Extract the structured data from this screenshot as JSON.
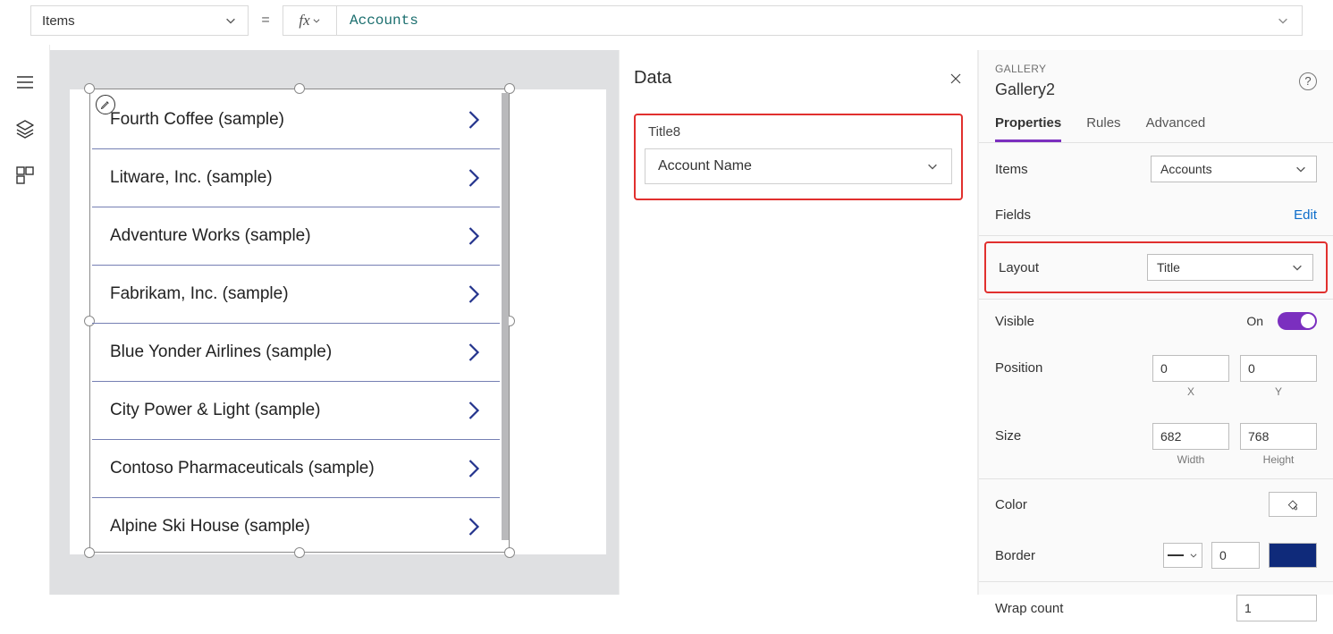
{
  "formula_bar": {
    "property": "Items",
    "equals": "=",
    "formula": "Accounts"
  },
  "gallery_items": [
    {
      "title": "Fourth Coffee (sample)"
    },
    {
      "title": "Litware, Inc. (sample)"
    },
    {
      "title": "Adventure Works (sample)"
    },
    {
      "title": "Fabrikam, Inc. (sample)"
    },
    {
      "title": "Blue Yonder Airlines (sample)"
    },
    {
      "title": "City Power & Light (sample)"
    },
    {
      "title": "Contoso Pharmaceuticals (sample)"
    },
    {
      "title": "Alpine Ski House (sample)"
    }
  ],
  "data_panel": {
    "title": "Data",
    "field_label": "Title8",
    "field_value": "Account Name"
  },
  "prop_panel": {
    "eyebrow": "GALLERY",
    "name": "Gallery2",
    "tabs": {
      "properties": "Properties",
      "rules": "Rules",
      "advanced": "Advanced"
    },
    "items_label": "Items",
    "items_value": "Accounts",
    "fields_label": "Fields",
    "fields_edit": "Edit",
    "layout_label": "Layout",
    "layout_value": "Title",
    "visible_label": "Visible",
    "visible_value": "On",
    "position_label": "Position",
    "pos_x": "0",
    "pos_y": "0",
    "pos_x_cap": "X",
    "pos_y_cap": "Y",
    "size_label": "Size",
    "width": "682",
    "height": "768",
    "width_cap": "Width",
    "height_cap": "Height",
    "color_label": "Color",
    "border_label": "Border",
    "border_width": "0",
    "wrap_label": "Wrap count",
    "wrap_value": "1"
  }
}
